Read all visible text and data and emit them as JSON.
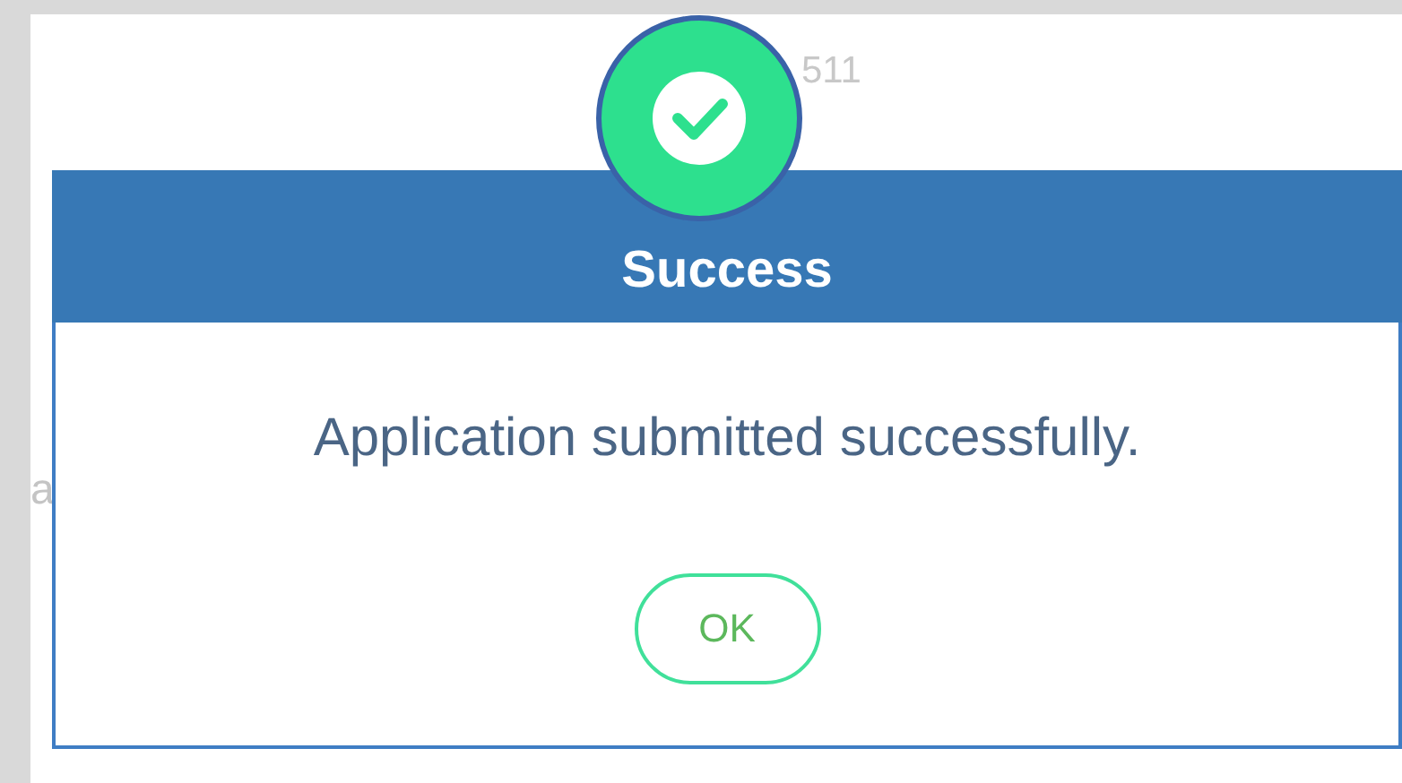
{
  "background": {
    "texts": [
      "511",
      "a"
    ]
  },
  "dialog": {
    "kind": "success",
    "title": "Success",
    "message": "Application submitted successfully.",
    "buttons": [
      "OK"
    ]
  }
}
